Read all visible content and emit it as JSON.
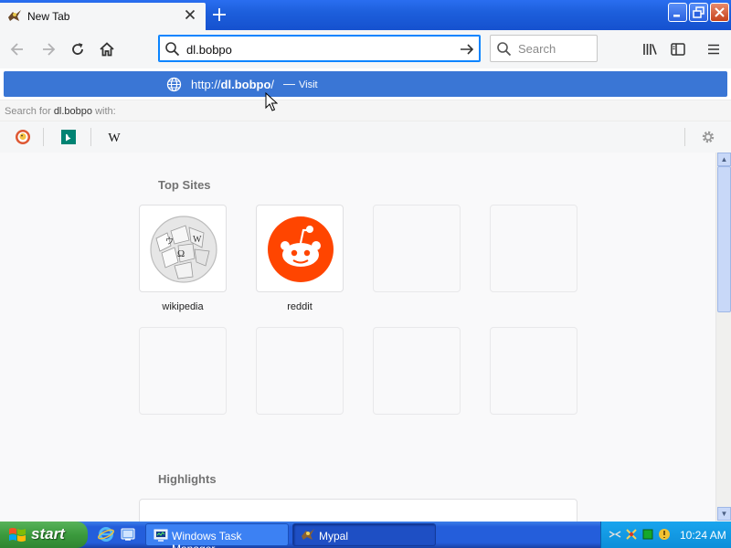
{
  "window": {
    "tab_title": "New Tab",
    "tab_close_icon": "close-icon",
    "new_tab_icon": "plus-icon"
  },
  "navbar": {
    "url_value": "dl.bobpo",
    "search_placeholder": "Search"
  },
  "dropdown": {
    "suggestion_prefix": "http://",
    "suggestion_host": "dl.bobpo",
    "suggestion_suffix": "/",
    "suggestion_sep": "—",
    "suggestion_action": "Visit",
    "search_for_prefix": "Search for",
    "search_for_query": "dl.bobpo",
    "search_for_suffix": "with:",
    "engines": [
      "duckduckgo",
      "bing",
      "wikipedia"
    ]
  },
  "content": {
    "top_sites_title": "Top Sites",
    "top_sites": [
      {
        "label": "wikipedia"
      },
      {
        "label": "reddit"
      }
    ],
    "highlights_title": "Highlights"
  },
  "taskbar": {
    "start_label": "start",
    "buttons": [
      {
        "label": "Windows Task Manager"
      },
      {
        "label": "Mypal"
      }
    ],
    "clock": "10:24 AM"
  },
  "colors": {
    "accent": "#0a84ff",
    "suggestion_bg": "#3a76d5",
    "xp_blue": "#245edb",
    "reddit": "#ff4500"
  }
}
